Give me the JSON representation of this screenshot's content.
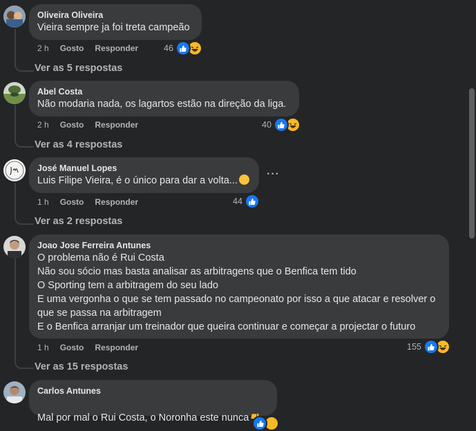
{
  "comments": [
    {
      "author": "Oliveira Oliveira",
      "text": "Vieira sempre ja foi treta campeão",
      "time": "2 h",
      "like_label": "Gosto",
      "reply_label": "Responder",
      "reactions": "46",
      "replies": "Ver as 5 respostas"
    },
    {
      "author": "Abel Costa",
      "text": "Não modaria nada, os lagartos estão na direção da liga.",
      "time": "2 h",
      "like_label": "Gosto",
      "reply_label": "Responder",
      "reactions": "40",
      "replies": "Ver as 4 respostas"
    },
    {
      "author": "José Manuel Lopes",
      "text": "Luis Filipe Vieira, é o único para dar a volta...",
      "time": "1 h",
      "like_label": "Gosto",
      "reply_label": "Responder",
      "reactions": "44",
      "replies": "Ver as 2 respostas"
    },
    {
      "author": "Joao Jose Ferreira Antunes",
      "text": "O problema não é Rui Costa\nNão sou sócio mas basta analisar as arbitragens que o Benfica tem tido\nO Sporting tem a arbitragem do seu lado\nE uma vergonha o que se tem passado no campeonato por isso a que atacar e resolver o que se passa na arbitragem\nE o Benfica arranjar um treinador que queira continuar e começar a projectar o futuro",
      "time": "1 h",
      "like_label": "Gosto",
      "reply_label": "Responder",
      "reactions": "155",
      "replies": "Ver as 15 respostas"
    },
    {
      "author": "Carlos Antunes",
      "text": "Mal por mal o Rui Costa, o Noronha este nunca"
    }
  ],
  "colors": {
    "background": "#242526",
    "bubble": "#3a3b3c",
    "like": "#1877f2",
    "haha": "#f7b928"
  }
}
